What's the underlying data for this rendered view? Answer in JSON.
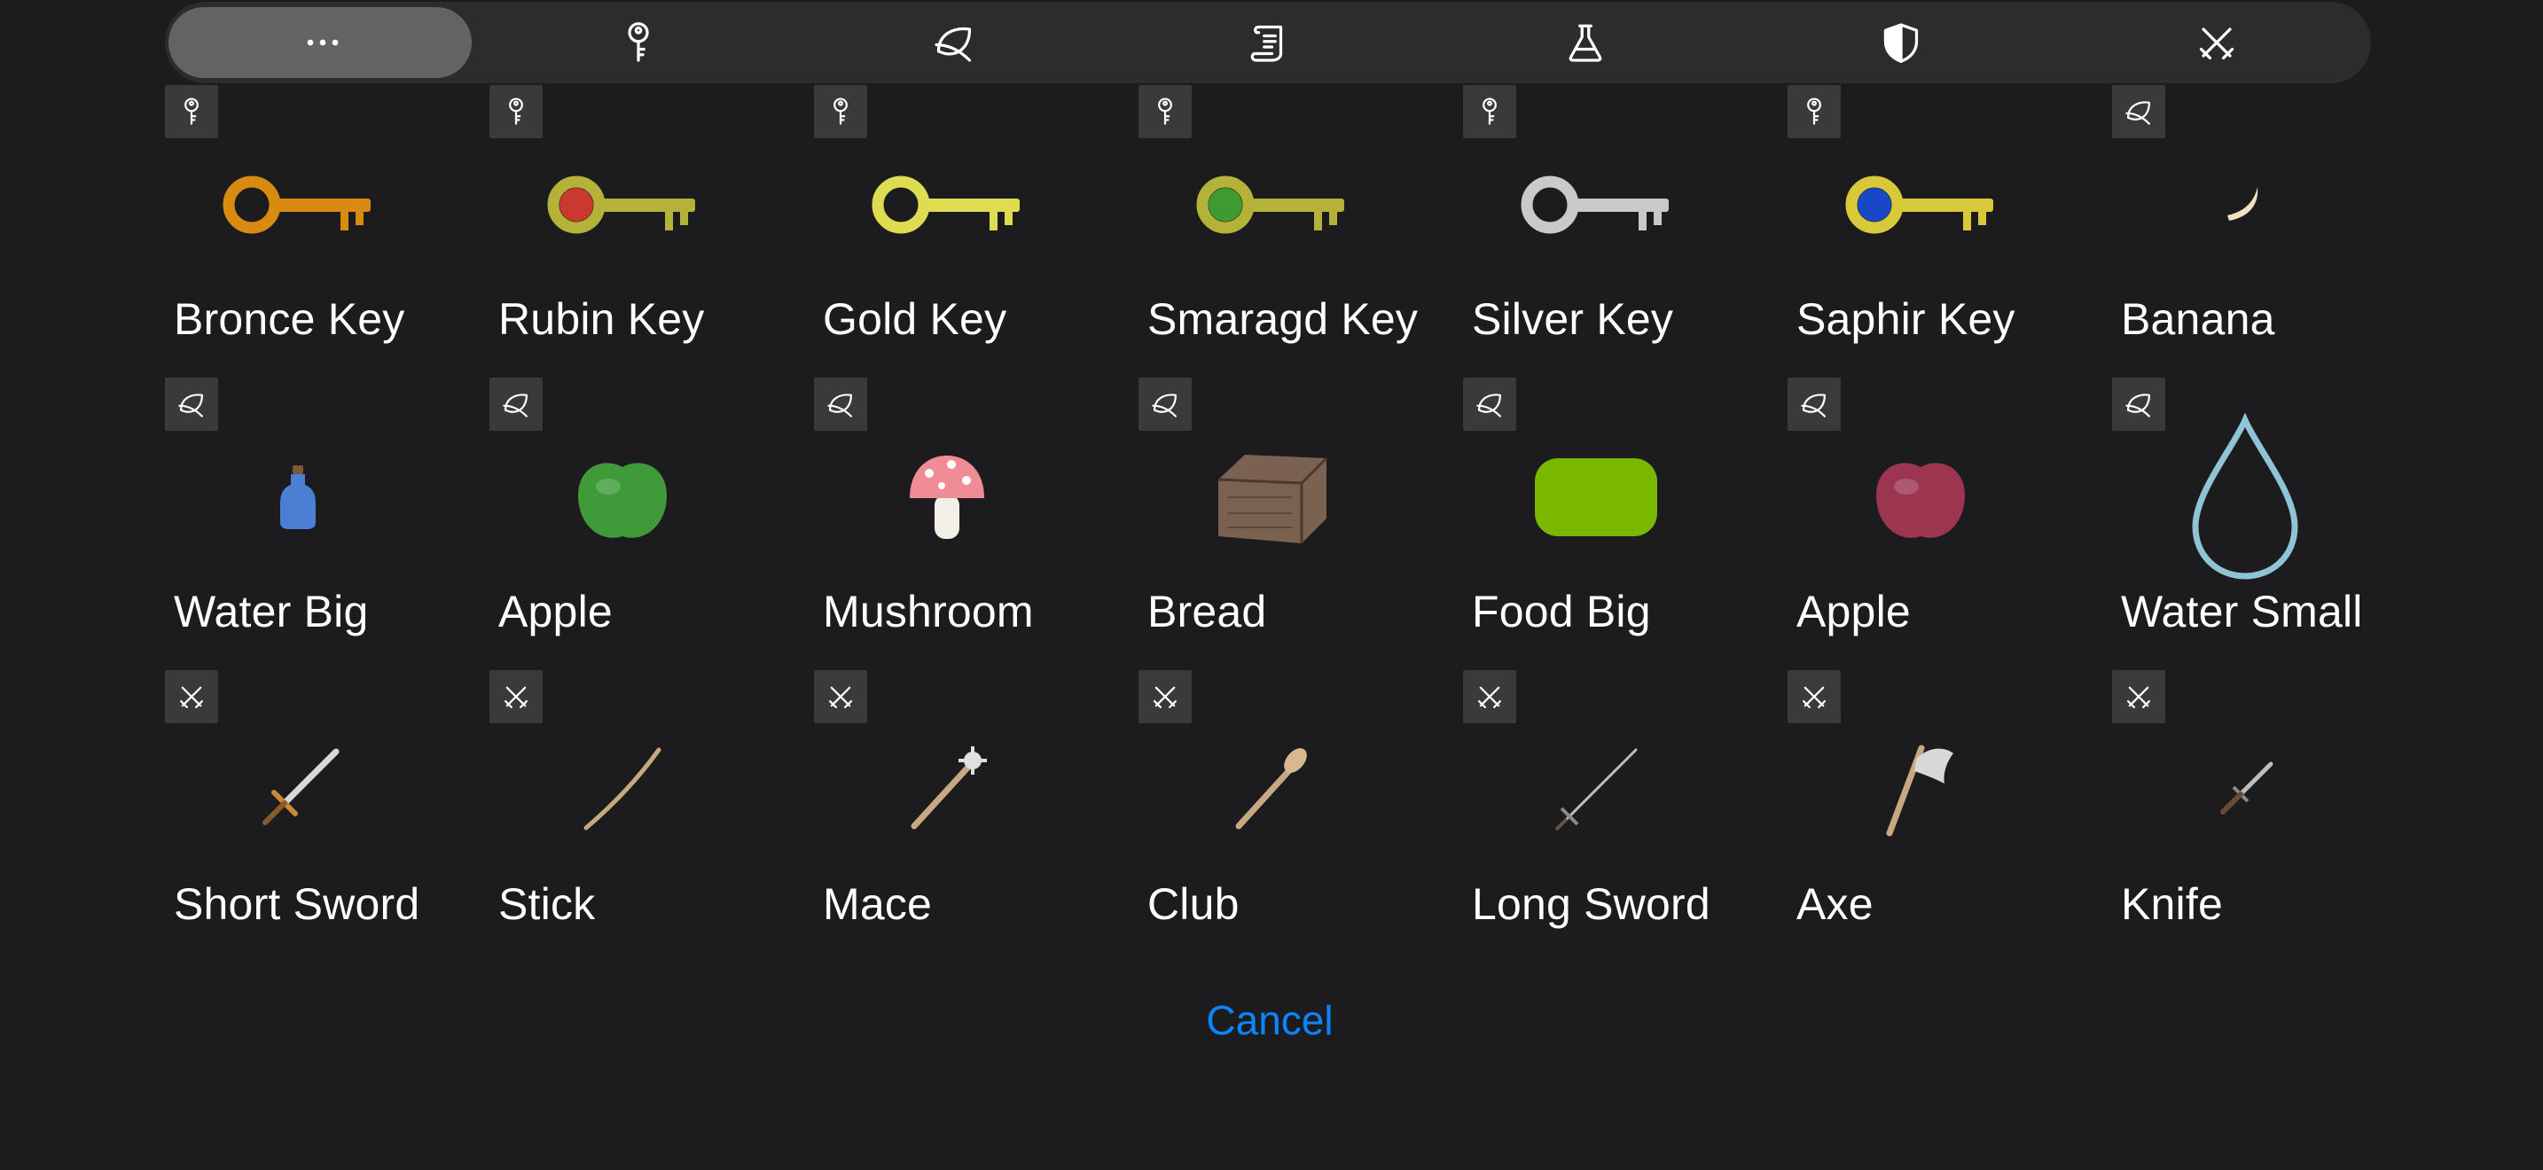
{
  "tabs": [
    {
      "icon": "more-icon",
      "selected": true
    },
    {
      "icon": "key-icon",
      "selected": false
    },
    {
      "icon": "leaf-icon",
      "selected": false
    },
    {
      "icon": "scroll-icon",
      "selected": false
    },
    {
      "icon": "flask-icon",
      "selected": false
    },
    {
      "icon": "shield-icon",
      "selected": false
    },
    {
      "icon": "crossed-swords-icon",
      "selected": false
    }
  ],
  "items": [
    {
      "name": "Bronce Key",
      "category": "key-icon",
      "thumb": "key",
      "color": "#d98a10",
      "gem": ""
    },
    {
      "name": "Rubin Key",
      "category": "key-icon",
      "thumb": "key",
      "color": "#b5b23a",
      "gem": "#c8392e"
    },
    {
      "name": "Gold Key",
      "category": "key-icon",
      "thumb": "key",
      "color": "#dedd52",
      "gem": ""
    },
    {
      "name": "Smaragd Key",
      "category": "key-icon",
      "thumb": "key",
      "color": "#b5b23a",
      "gem": "#3f9b2f"
    },
    {
      "name": "Silver Key",
      "category": "key-icon",
      "thumb": "key",
      "color": "#c9c9c9",
      "gem": ""
    },
    {
      "name": "Saphir Key",
      "category": "key-icon",
      "thumb": "key",
      "color": "#d8c93a",
      "gem": "#1848c8"
    },
    {
      "name": "Banana",
      "category": "leaf-icon",
      "thumb": "banana",
      "color": "#efe3c2",
      "gem": ""
    },
    {
      "name": "Water Big",
      "category": "leaf-icon",
      "thumb": "bottle",
      "color": "#4a7fd4",
      "gem": ""
    },
    {
      "name": "Apple",
      "category": "leaf-icon",
      "thumb": "apple",
      "color": "#3f9b3a",
      "gem": ""
    },
    {
      "name": "Mushroom",
      "category": "leaf-icon",
      "thumb": "mushroom",
      "color": "#f08c95",
      "gem": ""
    },
    {
      "name": "Bread",
      "category": "leaf-icon",
      "thumb": "bread",
      "color": "#7a6150",
      "gem": ""
    },
    {
      "name": "Food Big",
      "category": "leaf-icon",
      "thumb": "foodbig",
      "color": "#7ab800",
      "gem": ""
    },
    {
      "name": "Apple",
      "category": "leaf-icon",
      "thumb": "apple",
      "color": "#9b3550",
      "gem": ""
    },
    {
      "name": "Water Small",
      "category": "leaf-icon",
      "thumb": "drop",
      "color": "#8fc3d6",
      "gem": ""
    },
    {
      "name": "Short Sword",
      "category": "crossed-swords-icon",
      "thumb": "shortsword",
      "color": "#d8d8d8",
      "gem": ""
    },
    {
      "name": "Stick",
      "category": "crossed-swords-icon",
      "thumb": "stick",
      "color": "#c8a880",
      "gem": ""
    },
    {
      "name": "Mace",
      "category": "crossed-swords-icon",
      "thumb": "mace",
      "color": "#c8a880",
      "gem": ""
    },
    {
      "name": "Club",
      "category": "crossed-swords-icon",
      "thumb": "club",
      "color": "#c8a880",
      "gem": ""
    },
    {
      "name": "Long Sword",
      "category": "crossed-swords-icon",
      "thumb": "longsword",
      "color": "#bdbdbd",
      "gem": ""
    },
    {
      "name": "Axe",
      "category": "crossed-swords-icon",
      "thumb": "axe",
      "color": "#c8a880",
      "gem": ""
    },
    {
      "name": "Knife",
      "category": "crossed-swords-icon",
      "thumb": "knife",
      "color": "#bdbdbd",
      "gem": ""
    }
  ],
  "cancel_label": "Cancel"
}
